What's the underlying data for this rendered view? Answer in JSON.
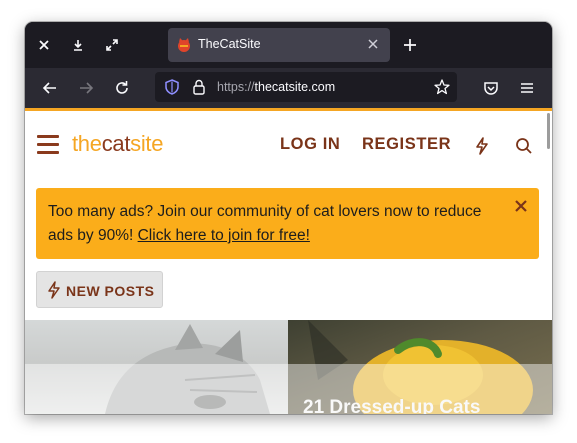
{
  "browser": {
    "tab": {
      "title": "TheCatSite"
    },
    "url": {
      "scheme": "https://",
      "host": "thecatsite.com"
    },
    "accent_color": "#f5a623",
    "icons": [
      "close-icon",
      "download-icon",
      "expand-icon",
      "new-tab-icon",
      "back-icon",
      "forward-icon",
      "reload-icon",
      "shield-icon",
      "lock-icon",
      "star-icon",
      "pocket-icon",
      "menu-icon"
    ]
  },
  "site": {
    "logo": {
      "part1": "the",
      "part2": "cat",
      "part3": "site"
    },
    "nav": {
      "login": "LOG IN",
      "register": "REGISTER"
    },
    "banner": {
      "text": "Too many ads? Join our community of cat lovers now to reduce ads by 90%! ",
      "link": "Click here to join for free!"
    },
    "new_posts_button": "NEW POSTS",
    "cards": [
      {
        "title": ""
      },
      {
        "title": "21 Dressed-up Cats"
      }
    ]
  }
}
